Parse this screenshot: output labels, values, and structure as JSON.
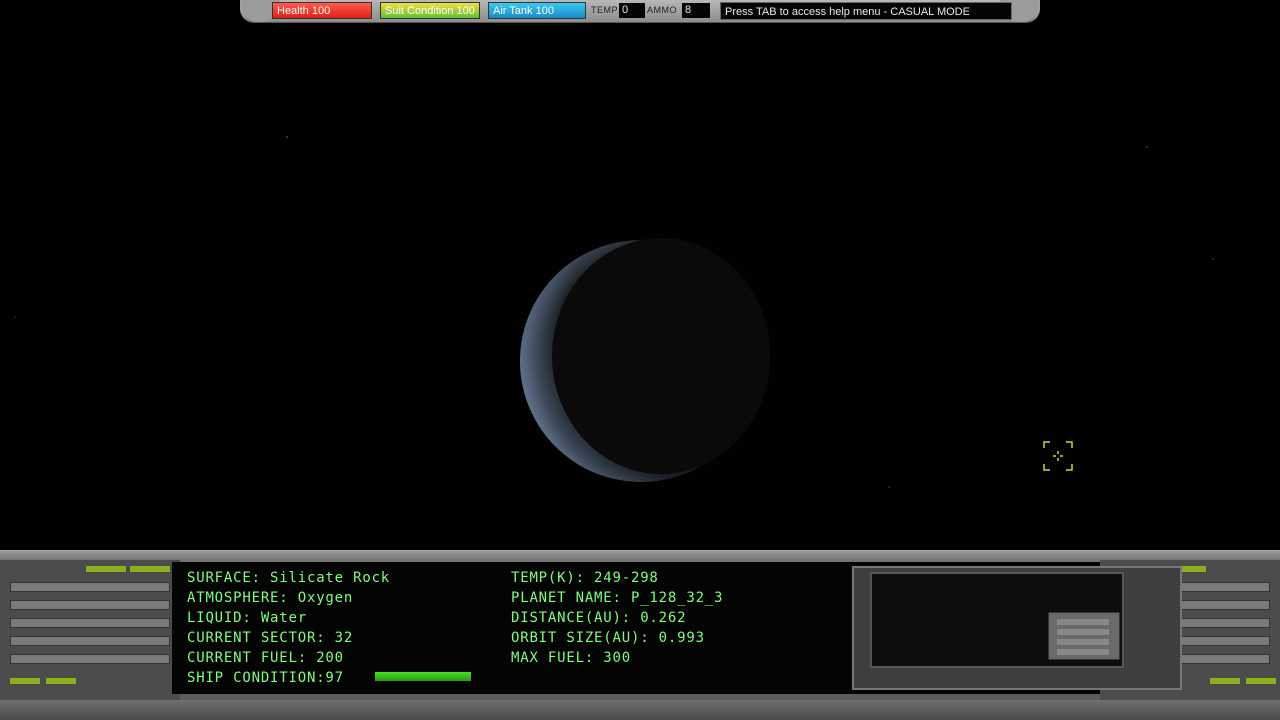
{
  "top_hud": {
    "health_label": "Health 100",
    "suit_label": "Suit Condition 100",
    "air_label": "Air Tank 100",
    "temp_label": "TEMP",
    "temp_value": "0",
    "ammo_label": "AMMO",
    "ammo_value": "8",
    "message": "Press TAB to access help menu - CASUAL MODE"
  },
  "planet_info": {
    "surface": "SURFACE: Silicate Rock",
    "atmosphere": "ATMOSPHERE: Oxygen",
    "liquid": "LIQUID: Water",
    "current_sector": "CURRENT SECTOR: 32",
    "current_fuel": "CURRENT FUEL: 200",
    "ship_condition": "SHIP CONDITION:97",
    "temp_k": "TEMP(K): 249-298",
    "planet_name": "PLANET NAME: P_128_32_3",
    "distance": "DISTANCE(AU): 0.262",
    "orbit_size": "ORBIT SIZE(AU): 0.993",
    "max_fuel": "MAX FUEL: 300"
  },
  "ship_condition_fraction": 0.97,
  "colors": {
    "info_text": "#7dff7a",
    "health": "#e0201a",
    "suit": "#c8d830",
    "air": "#1a8ac8",
    "reticle": "#c8d84a"
  },
  "icons": {
    "reticle": "crosshair-reticle-icon"
  }
}
